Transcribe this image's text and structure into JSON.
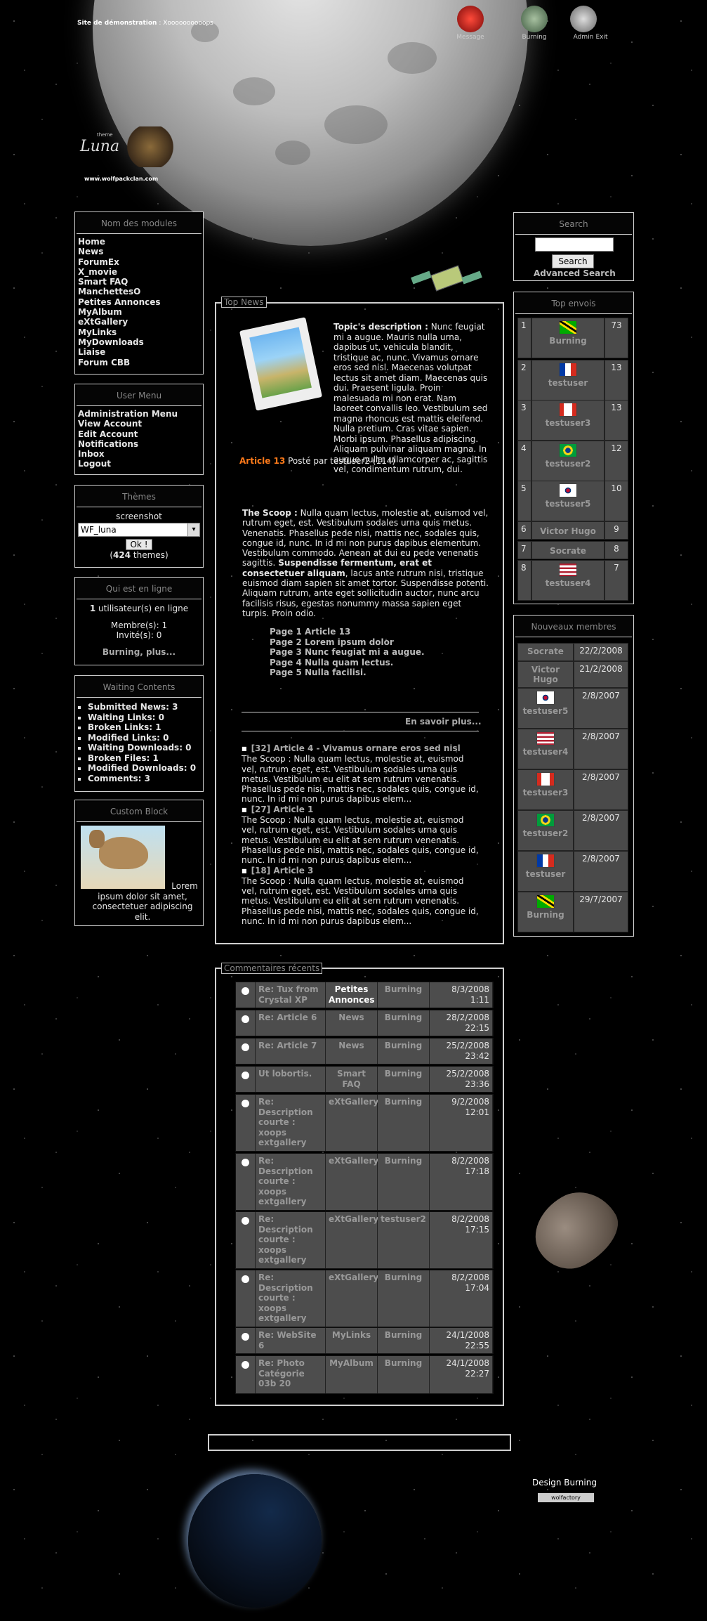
{
  "header": {
    "site_label": "Site de démonstration",
    "site_sub": ": Xoooooooooops",
    "logo_theme": "theme",
    "logo_name": "Luna",
    "logo_url": "www.wolfpackclan.com",
    "nav": [
      {
        "label": "Message",
        "icon": "message-icon"
      },
      {
        "label": "Burning",
        "icon": "user-icon"
      },
      {
        "label": "Admin",
        "icon": "admin-icon"
      },
      {
        "label": "Exit",
        "icon": "exit-icon"
      }
    ]
  },
  "modules": {
    "title": "Nom des modules",
    "items": [
      "Home",
      "News",
      "ForumEx",
      "X_movie",
      "Smart FAQ",
      "ManchettesO",
      "Petites Annonces",
      "MyAlbum",
      "eXtGallery",
      "MyLinks",
      "MyDownloads",
      "Liaise",
      "Forum CBB"
    ]
  },
  "user_menu": {
    "title": "User Menu",
    "items": [
      "Administration Menu",
      "View Account",
      "Edit Account",
      "Notifications",
      "Inbox",
      "Logout"
    ]
  },
  "themes": {
    "title": "Thèmes",
    "caption": "screenshot",
    "selected": "WF_luna",
    "ok": "Ok !",
    "count": "424",
    "count_suffix": " themes)",
    "count_prefix": "("
  },
  "online": {
    "title": "Qui est en ligne",
    "count": "1",
    "users_text": " utilisateur(s) en ligne",
    "members": "Membre(s): 1",
    "guests": "Invité(s): 0",
    "more": "Burning, plus..."
  },
  "waiting": {
    "title": "Waiting Contents",
    "items": [
      "Submitted News: 3",
      "Waiting Links: 0",
      "Broken Links: 1",
      "Modified Links: 0",
      "Waiting Downloads: 0",
      "Broken Files: 1",
      "Modified Downloads: 0",
      "Comments: 3"
    ]
  },
  "custom": {
    "title": "Custom Block",
    "text": "Lorem ipsum dolor sit amet, consectetuer adipiscing elit."
  },
  "search": {
    "title": "Search",
    "button": "Search",
    "advanced": "Advanced Search"
  },
  "top_envois": {
    "title": "Top envois",
    "rows": [
      {
        "rank": "1",
        "name": "Burning",
        "count": "73",
        "flag": "jamaica"
      },
      {
        "rank": "2",
        "name": "testuser",
        "count": "13",
        "flag": "france"
      },
      {
        "rank": "3",
        "name": "testuser3",
        "count": "13",
        "flag": "canada"
      },
      {
        "rank": "4",
        "name": "testuser2",
        "count": "12",
        "flag": "brazil"
      },
      {
        "rank": "5",
        "name": "testuser5",
        "count": "10",
        "flag": "korea"
      },
      {
        "rank": "6",
        "name": "Victor Hugo",
        "count": "9",
        "flag": ""
      },
      {
        "rank": "7",
        "name": "Socrate",
        "count": "8",
        "flag": ""
      },
      {
        "rank": "8",
        "name": "testuser4",
        "count": "7",
        "flag": "usa"
      }
    ]
  },
  "new_members": {
    "title": "Nouveaux membres",
    "rows": [
      {
        "name": "Socrate",
        "date": "22/2/2008",
        "flag": ""
      },
      {
        "name": "Victor Hugo",
        "date": "21/2/2008",
        "flag": ""
      },
      {
        "name": "testuser5",
        "date": "2/8/2007",
        "flag": "korea"
      },
      {
        "name": "testuser4",
        "date": "2/8/2007",
        "flag": "usa"
      },
      {
        "name": "testuser3",
        "date": "2/8/2007",
        "flag": "canada"
      },
      {
        "name": "testuser2",
        "date": "2/8/2007",
        "flag": "brazil"
      },
      {
        "name": "testuser",
        "date": "2/8/2007",
        "flag": "france"
      },
      {
        "name": "Burning",
        "date": "29/7/2007",
        "flag": "jamaica"
      }
    ]
  },
  "top_news": {
    "label": "Top News",
    "topic_label": "Topic's description :",
    "topic_text": " Nunc feugiat mi a augue. Mauris nulla urna, dapibus ut, vehicula blandit, tristique ac, nunc. Vivamus ornare eros sed nisl. Maecenas volutpat lectus sit amet diam. Maecenas quis dui. Praesent ligula. Proin malesuada mi non erat. Nam laoreet convallis leo. Vestibulum sed magna rhoncus est mattis eleifend. Nulla pretium. Cras vitae sapien. Morbi ipsum. Phasellus adipiscing. Aliquam pulvinar aliquam magna. In augue nulla, ullamcorper ac, sagittis vel, condimentum rutrum, dui.",
    "article_title": "Article 13",
    "posted": " Posté par testuser2 (114)",
    "scoop_label": "The Scoop :",
    "scoop_text": " Nulla quam lectus, molestie at, euismod vel, rutrum eget, est. Vestibulum sodales urna quis metus. Venenatis. Phasellus pede nisi, mattis nec, sodales quis, congue id, nunc. In id mi non purus dapibus elementum. Vestibulum commodo. Aenean at dui eu pede venenatis sagittis. ",
    "scoop_bold": "Suspendisse fermentum, erat et consectetuer aliquam",
    "scoop_tail": ", lacus ante rutrum nisi, tristique euismod diam sapien sit amet tortor. Suspendisse potenti. Aliquam rutrum, ante eget sollicitudin auctor, nunc arcu facilisis risus, egestas nonummy massa sapien eget turpis. Proin odio.",
    "pages": [
      "Page 1 Article 13",
      "Page 2 Lorem ipsum dolor",
      "Page 3 Nunc feugiat mi a augue.",
      "Page 4 Nulla quam lectus.",
      "Page 5 Nulla facilisi."
    ],
    "more": "En savoir plus...",
    "items": [
      {
        "title": "[32] Article 4 - Vivamus ornare eros sed nisl",
        "text": "The Scoop : Nulla quam lectus, molestie at, euismod vel, rutrum eget, est. Vestibulum sodales urna quis metus. Vestibulum eu elit at sem rutrum venenatis. Phasellus pede nisi, mattis nec, sodales quis, congue id, nunc. In id mi non purus dapibus elem..."
      },
      {
        "title": "[27] Article 1",
        "text": "The Scoop : Nulla quam lectus, molestie at, euismod vel, rutrum eget, est. Vestibulum sodales urna quis metus. Vestibulum eu elit at sem rutrum venenatis. Phasellus pede nisi, mattis nec, sodales quis, congue id, nunc. In id mi non purus dapibus elem..."
      },
      {
        "title": "[18] Article 3",
        "text": "The Scoop : Nulla quam lectus, molestie at, euismod vel, rutrum eget, est. Vestibulum sodales urna quis metus. Vestibulum eu elit at sem rutrum venenatis. Phasellus pede nisi, mattis nec, sodales quis, congue id, nunc. In id mi non purus dapibus elem..."
      }
    ]
  },
  "comments": {
    "label": "Commentaires récents",
    "rows": [
      {
        "title": "Re: Tux from Crystal XP",
        "module": "Petites Annonces",
        "user": "Burning",
        "date": "8/3/2008 1:11"
      },
      {
        "title": "Re: Article 6",
        "module": "News",
        "user": "Burning",
        "date": "28/2/2008 22:15"
      },
      {
        "title": "Re: Article 7",
        "module": "News",
        "user": "Burning",
        "date": "25/2/2008 23:42"
      },
      {
        "title": "Ut lobortis.",
        "module": "Smart FAQ",
        "user": "Burning",
        "date": "25/2/2008 23:36"
      },
      {
        "title": "Re: Description courte : xoops extgallery",
        "module": "eXtGallery",
        "user": "Burning",
        "date": "9/2/2008 12:01"
      },
      {
        "title": "Re: Description courte : xoops extgallery",
        "module": "eXtGallery",
        "user": "Burning",
        "date": "8/2/2008 17:18"
      },
      {
        "title": "Re: Description courte : xoops extgallery",
        "module": "eXtGallery",
        "user": "testuser2",
        "date": "8/2/2008 17:15"
      },
      {
        "title": "Re: Description courte : xoops extgallery",
        "module": "eXtGallery",
        "user": "Burning",
        "date": "8/2/2008 17:04"
      },
      {
        "title": "Re: WebSite 6",
        "module": "MyLinks",
        "user": "Burning",
        "date": "24/1/2008 22:55"
      },
      {
        "title": "Re: Photo Catégorie 03b 20",
        "module": "MyAlbum",
        "user": "Burning",
        "date": "24/1/2008 22:27"
      }
    ]
  },
  "footer": {
    "design": "Design Burning",
    "badge": "wolfactory"
  },
  "colors": {
    "article": "#ff7a1a",
    "border": "#cfcfcf",
    "cell": "#4d4d4d"
  }
}
